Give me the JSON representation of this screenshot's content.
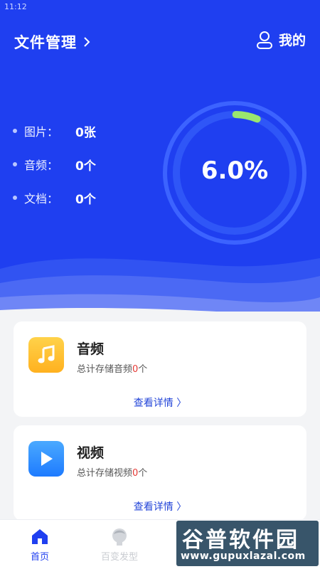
{
  "status_bar": {
    "time": "11:12"
  },
  "header": {
    "title": "文件管理",
    "mine_label": "我的"
  },
  "stats": [
    {
      "label": "图片：",
      "value": "0张"
    },
    {
      "label": "音频：",
      "value": "0个"
    },
    {
      "label": "文档：",
      "value": "0个"
    }
  ],
  "gauge": {
    "percent_text": "6.0%",
    "fraction": 0.06
  },
  "cards": {
    "audio": {
      "title": "音频",
      "sub_prefix": "总计存储音频",
      "count": "0",
      "sub_suffix": "个",
      "link": "查看详情 〉"
    },
    "video": {
      "title": "视频",
      "sub_prefix": "总计存储视频",
      "count": "0",
      "sub_suffix": "个",
      "link": "查看详情 〉"
    }
  },
  "tabbar": {
    "home_label": "首页",
    "hair_label": "百变发型"
  },
  "watermark": {
    "main": "谷普软件园",
    "url": "www.gupuxlazal.com"
  },
  "colors": {
    "hero_blue": "#1f3ff0",
    "progress_green": "#9ae66e",
    "link_blue": "#2345d8",
    "count_red": "#e53935"
  }
}
